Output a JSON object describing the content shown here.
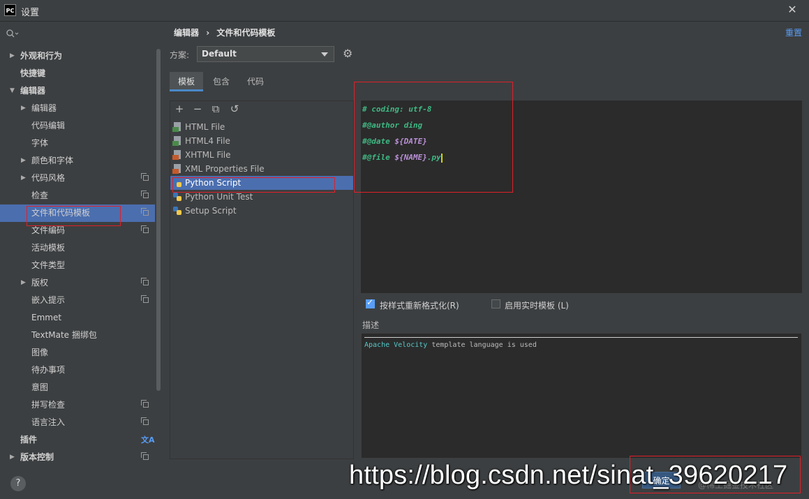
{
  "window": {
    "app_icon": "PC",
    "title": "设置",
    "close": "✕"
  },
  "sidebar": {
    "items": [
      {
        "label": "外观和行为",
        "arrow": "▶"
      },
      {
        "label": "快捷键"
      },
      {
        "label": "编辑器",
        "arrow": "▼"
      },
      {
        "label": "编辑器",
        "arrow": "▶"
      },
      {
        "label": "代码编辑"
      },
      {
        "label": "字体"
      },
      {
        "label": "颜色和字体",
        "arrow": "▶"
      },
      {
        "label": "代码风格",
        "arrow": "▶"
      },
      {
        "label": "检查"
      },
      {
        "label": "文件和代码模板"
      },
      {
        "label": "文件编码"
      },
      {
        "label": "活动模板"
      },
      {
        "label": "文件类型"
      },
      {
        "label": "版权",
        "arrow": "▶"
      },
      {
        "label": "嵌入提示"
      },
      {
        "label": "Emmet"
      },
      {
        "label": "TextMate 捆绑包"
      },
      {
        "label": "图像"
      },
      {
        "label": "待办事项"
      },
      {
        "label": "意图"
      },
      {
        "label": "拼写检查"
      },
      {
        "label": "语言注入"
      },
      {
        "label": "插件"
      },
      {
        "label": "版本控制",
        "arrow": "▶"
      }
    ]
  },
  "header": {
    "breadcrumb_1": "编辑器",
    "breadcrumb_sep": "›",
    "breadcrumb_2": "文件和代码模板",
    "reset": "重置"
  },
  "scheme": {
    "label": "方案:",
    "value": "Default"
  },
  "tabs": [
    "模板",
    "包含",
    "代码"
  ],
  "toolbar": {
    "add": "+",
    "remove": "−",
    "copy": "⧉",
    "reset": "↺"
  },
  "files": [
    {
      "name": "HTML File",
      "icon": "html-icon",
      "color": "#4a8a4a"
    },
    {
      "name": "HTML4 File",
      "icon": "html-icon",
      "color": "#4a8a4a"
    },
    {
      "name": "XHTML File",
      "icon": "xhtml-icon",
      "color": "#c65a2a"
    },
    {
      "name": "XML Properties File",
      "icon": "xml-icon",
      "color": "#c65a2a"
    },
    {
      "name": "Python Script",
      "icon": "python-icon",
      "selected": true
    },
    {
      "name": "Python Unit Test",
      "icon": "python-icon"
    },
    {
      "name": "Setup Script",
      "icon": "python-icon"
    }
  ],
  "editor": {
    "line1": "# coding: utf-8",
    "line2": "#@author ding",
    "line3_a": "#@date ",
    "line3_b": "${DATE}",
    "line4_a": "#@file ",
    "line4_b": "${NAME}",
    "line4_c": ".py"
  },
  "options": {
    "reformat": "按样式重新格式化(R)",
    "reformat_checked": true,
    "live_templates": "启用实时模板 (L)",
    "live_checked": false
  },
  "description": {
    "label": "描述",
    "kw": "Apache Velocity",
    "rest": " template language is used"
  },
  "footer": {
    "help": "?",
    "ok": "确定",
    "watermark": "https://blog.csdn.net/sinat_39620217",
    "watermark_small": "@稀土掘金技术社区"
  },
  "colors": {
    "accent": "#4b6eaf",
    "link": "#589df6",
    "annotation": "#e0202a"
  }
}
